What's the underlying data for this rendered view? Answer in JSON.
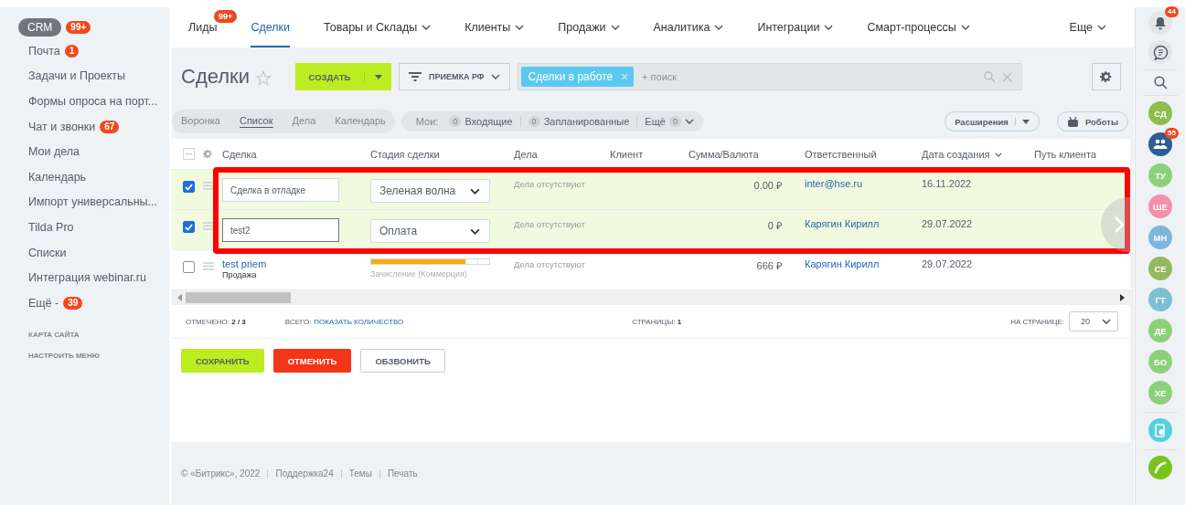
{
  "sidebar": {
    "crm": {
      "label": "CRM",
      "badge": "99+"
    },
    "items": [
      {
        "label": "Почта",
        "badge": "1"
      },
      {
        "label": "Задачи и Проекты"
      },
      {
        "label": "Формы опроса на порт..."
      },
      {
        "label": "Чат и звонки",
        "badge": "67"
      },
      {
        "label": "Мои дела"
      },
      {
        "label": "Календарь"
      },
      {
        "label": "Импорт универсальны..."
      },
      {
        "label": "Tilda Pro"
      },
      {
        "label": "Списки"
      },
      {
        "label": "Интеграция webinar.ru"
      },
      {
        "label": "Ещё -",
        "badge": "39"
      }
    ],
    "links": [
      "КАРТА САЙТА",
      "НАСТРОИТЬ МЕНЮ"
    ]
  },
  "top_nav": [
    {
      "label": "Лиды",
      "selected": false,
      "badge": "99+",
      "dropdown": false
    },
    {
      "label": "Сделки",
      "selected": true,
      "dropdown": false
    },
    {
      "label": "Товары и Склады",
      "selected": false,
      "dropdown": true
    },
    {
      "label": "Клиенты",
      "selected": false,
      "dropdown": true
    },
    {
      "label": "Продажи",
      "selected": false,
      "dropdown": true
    },
    {
      "label": "Аналитика",
      "selected": false,
      "dropdown": true
    },
    {
      "label": "Интеграции",
      "selected": false,
      "dropdown": true
    },
    {
      "label": "Смарт-процессы",
      "selected": false,
      "dropdown": true
    },
    {
      "label": "Еще",
      "selected": false,
      "dropdown": true
    }
  ],
  "toolbar": {
    "title": "Сделки",
    "create": "СОЗДАТЬ",
    "filter": "ПРИЕМКА РФ",
    "filter_tag": "Сделки в работе",
    "search": {
      "placeholder": "+ поиск"
    }
  },
  "views": [
    {
      "label": "Воронка",
      "selected": false
    },
    {
      "label": "Список",
      "selected": true
    },
    {
      "label": "Дела",
      "selected": false
    },
    {
      "label": "Календарь",
      "selected": false
    }
  ],
  "counters": {
    "label": "Мои:",
    "items": [
      {
        "count": "0",
        "label": "Входящие",
        "dropdown": false
      },
      {
        "count": "0",
        "label": "Запланированные",
        "dropdown": false
      },
      {
        "label": "Ещё",
        "count": "0",
        "dropdown": true
      }
    ]
  },
  "extensions": "Расширения",
  "robots": "Роботы",
  "table": {
    "select_all_partial": true,
    "columns": [
      "Сделка",
      "Стадия сделки",
      "Дела",
      "Клиент",
      "Сумма/Валюта",
      "Ответственный",
      "Дата создания",
      "Путь клиента"
    ],
    "rows": [
      {
        "kind": "edit",
        "checked": true,
        "name": "Сделка в отладке",
        "focused": false,
        "stage": "Зеленая волна",
        "activities": "Дела отсутствуют",
        "amount": "0.00 ₽",
        "responsible": "inter@hse.ru",
        "date": "16.11.2022"
      },
      {
        "kind": "edit",
        "checked": true,
        "name": "test2",
        "focused": true,
        "stage": "Оплата",
        "activities": "Дела отсутствуют",
        "amount": "0 ₽",
        "responsible": "Карягин Кирилл",
        "date": "29.07.2022"
      },
      {
        "kind": "view",
        "checked": false,
        "name": "test priem",
        "subtitle": "Продажа",
        "level": 0.8,
        "stage": "Зачисление (Коммерция)",
        "activities": "Дела отсутствуют",
        "amount": "666 ₽",
        "responsible": "Карягин Кирилл",
        "date": "29.07.2022"
      }
    ]
  },
  "summary": {
    "selected_label": "ОТМЕЧЕНО:",
    "selected": "2 / 3",
    "total_label": "ВСЕГО:",
    "total_link": "ПОКАЗАТЬ КОЛИЧЕСТВО",
    "pages_label": "СТРАНИЦЫ:",
    "pages": "1",
    "per_page_label": "НА СТРАНИЦЕ:",
    "per_page": "20"
  },
  "actions": [
    {
      "label": "СОХРАНИТЬ",
      "kind": "primary"
    },
    {
      "label": "ОТМЕНИТЬ",
      "kind": "danger"
    },
    {
      "label": "ОБЗВОНИТЬ",
      "kind": "default"
    }
  ],
  "page_footer": [
    "© «Битрикс», 2022",
    "Поддержка24",
    "Темы",
    "Печать"
  ],
  "right_bar": {
    "notifications_badge": "44",
    "chat_badge": "55",
    "avatars": [
      {
        "initials": "ТУ",
        "color": "#8dd07a"
      },
      {
        "initials": "ШЕ",
        "color": "#f291a9"
      },
      {
        "initials": "МН",
        "color": "#7db5de"
      },
      {
        "initials": "СЕ",
        "color": "#93b960"
      },
      {
        "initials": "ГТ",
        "color": "#7fbfd6"
      },
      {
        "initials": "ДЕ",
        "color": "#8dd07a"
      },
      {
        "initials": "БО",
        "color": "#8dd07a"
      },
      {
        "initials": "ХЕ",
        "color": "#8dd07a"
      }
    ],
    "first_avatar": {
      "initials": "СД",
      "color": "#8fbc4c"
    }
  }
}
